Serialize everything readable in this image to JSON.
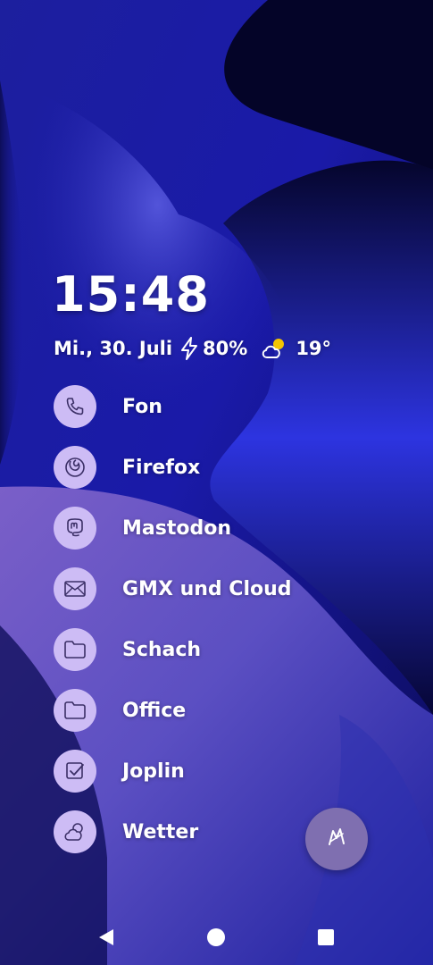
{
  "clock": {
    "time": "15:48"
  },
  "status": {
    "date": "Mi., 30. Juli",
    "battery_icon": "bolt-icon",
    "battery": "80%",
    "weather_icon": "partly-cloudy-icon",
    "temperature": "19°"
  },
  "apps": [
    {
      "label": "Fon",
      "icon": "phone-icon"
    },
    {
      "label": "Firefox",
      "icon": "firefox-icon"
    },
    {
      "label": "Mastodon",
      "icon": "mastodon-icon"
    },
    {
      "label": "GMX und Cloud",
      "icon": "mail-icon"
    },
    {
      "label": "Schach",
      "icon": "folder-icon"
    },
    {
      "label": "Office",
      "icon": "folder-icon"
    },
    {
      "label": "Joplin",
      "icon": "checkbox-icon"
    },
    {
      "label": "Wetter",
      "icon": "cloud-icon"
    }
  ],
  "fab": {
    "icon": "launcher-icon"
  },
  "navigation": {
    "back_icon": "back-icon",
    "home_icon": "home-icon",
    "recents_icon": "recents-icon"
  },
  "colors": {
    "icon_background": "#cdbcf5",
    "icon_stroke": "#3b2f66",
    "fab_background": "#7f6fb0",
    "wallpaper_dark": "#05052a",
    "wallpaper_blue": "#2a2fd6",
    "wallpaper_purple": "#8a6fd0"
  }
}
